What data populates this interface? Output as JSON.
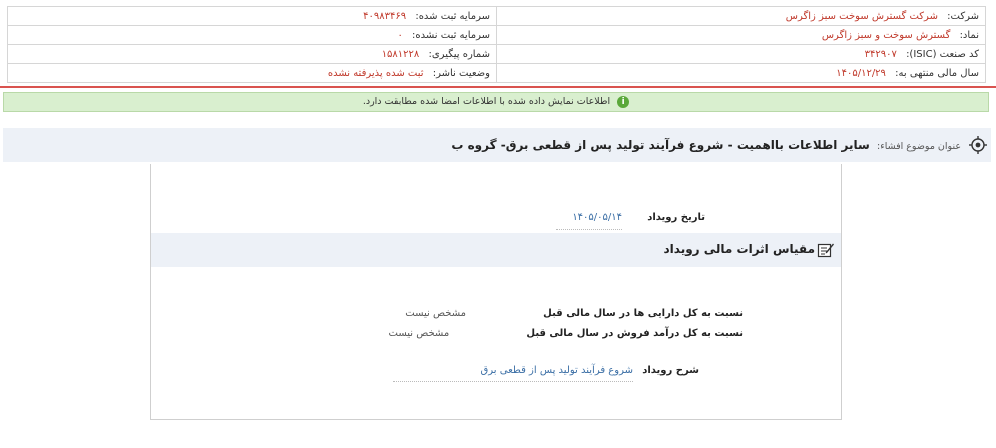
{
  "company": {
    "company_label": "شرکت:",
    "company_value": "شرکت گسترش سوخت سبز زاگرس",
    "symbol_label": "نماد:",
    "symbol_value": "گسترش سوخت و سبز زاگرس",
    "isic_label": "کد صنعت (ISIC):",
    "isic_value": "۳۴۲۹۰۷",
    "fiscal_label": "سال مالی منتهی به:",
    "fiscal_value": "۱۴۰۵/۱۲/۲۹",
    "registered_capital_label": "سرمایه ثبت شده:",
    "registered_capital_value": "۴۰۹۸۳۴۶۹",
    "unregistered_capital_label": "سرمایه ثبت نشده:",
    "unregistered_capital_value": "۰",
    "tracking_label": "شماره پیگیری:",
    "tracking_value": "۱۵۸۱۲۲۸",
    "publisher_status_label": "وضعیت ناشر:",
    "publisher_status_value": "ثبت شده پذیرفته نشده"
  },
  "notice": {
    "text": "اطلاعات نمایش داده شده با اطلاعات امضا شده مطابقت دارد."
  },
  "subject": {
    "label": "عنوان موضوع افشاء:",
    "value": "سایر اطلاعات بااهمیت - شروع فرآیند تولید پس از قطعی برق- گروه ب"
  },
  "event": {
    "date_label": "تاریخ رویداد",
    "date_value": "۱۴۰۵/۰۵/۱۴",
    "section_title": "مقیاس اثرات مالی رویداد",
    "assets_label": "نسبت به کل دارایی ها در سال مالی قبل",
    "assets_value": "مشخص نیست",
    "sales_label": "نسبت به کل درآمد فروش در سال مالی قبل",
    "sales_value": "مشخص نیست",
    "desc_label": "شرح رویداد",
    "desc_value": "شروع فرآیند تولید پس از قطعی برق"
  },
  "colors": {
    "value_red": "#c0392b",
    "link_blue": "#3a6ea5",
    "notice_green": "#d9efcf",
    "header_bg": "#edf1f7"
  }
}
